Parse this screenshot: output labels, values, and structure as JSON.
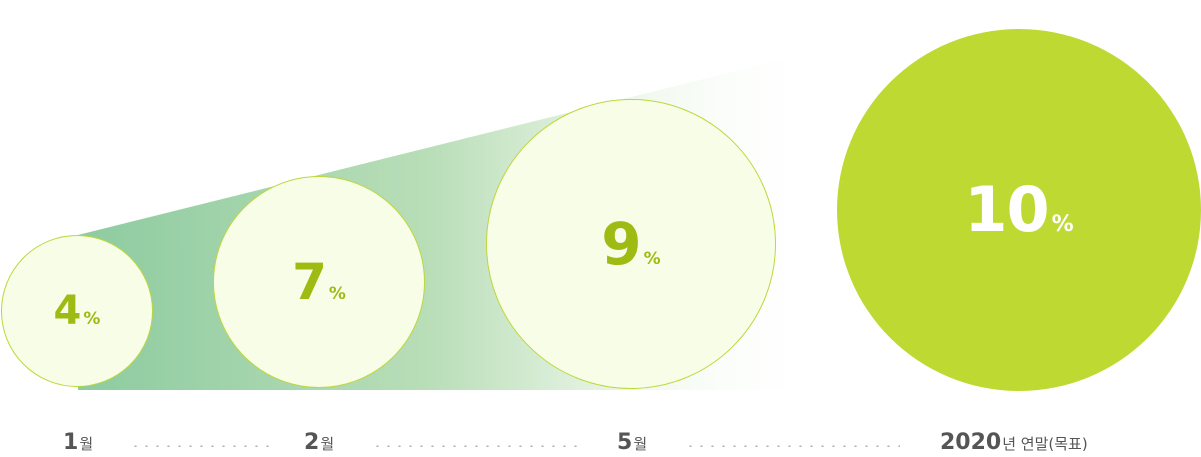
{
  "milestones": [
    {
      "value": "4",
      "unit": "%",
      "label_num": "1",
      "label_text": "월"
    },
    {
      "value": "7",
      "unit": "%",
      "label_num": "2",
      "label_text": "월"
    },
    {
      "value": "9",
      "unit": "%",
      "label_num": "5",
      "label_text": "월"
    },
    {
      "value": "10",
      "unit": "%",
      "label_num": "2020",
      "label_text": "년 연말(목표)"
    }
  ],
  "colors": {
    "accent": "#bed932",
    "value_text": "#9dbb12",
    "circle_fill": "#f8fde8",
    "band_start": "#8ecba0",
    "label_text": "#555555"
  }
}
